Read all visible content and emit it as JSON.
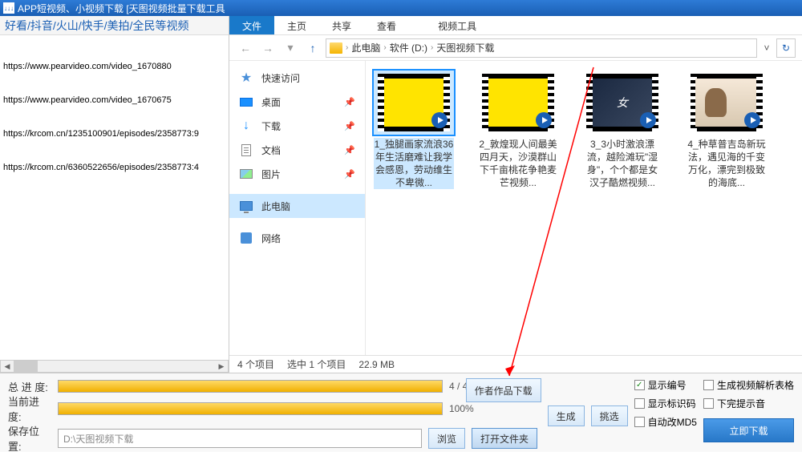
{
  "titlebar": {
    "text": "APP短视频、小视频下载 [天图视频批量下载工具"
  },
  "left_header": "好看/抖音/火山/快手/美拍/全民等视频",
  "urls": [
    "https://www.pearvideo.com/video_1670880",
    "https://www.pearvideo.com/video_1670675",
    "https://krcom.cn/1235100901/episodes/2358773:9",
    "https://krcom.cn/6360522656/episodes/2358773:4"
  ],
  "ribbon": {
    "file": "文件",
    "home": "主页",
    "share": "共享",
    "view": "查看",
    "video_tools": "视频工具"
  },
  "breadcrumb": {
    "pc": "此电脑",
    "drive": "软件 (D:)",
    "folder": "天图视频下载"
  },
  "sidebar": {
    "quick": "快速访问",
    "desktop": "桌面",
    "downloads": "下载",
    "documents": "文档",
    "pictures": "图片",
    "this_pc": "此电脑",
    "network": "网络"
  },
  "files": [
    {
      "name": "1_独腿画家流浪36年生活磨难让我学会感恩，劳动维生不卑微..."
    },
    {
      "name": "2_敦煌现人间最美四月天，沙漠群山下千亩桃花争艳麦芒视频..."
    },
    {
      "name": "3_3小时激浪漂流，越险滩玩\"湿身\"，个个都是女汉子酷燃视频..."
    },
    {
      "name": "4_种草普吉岛新玩法，遇见海的千变万化，漂完到极致的海底..."
    }
  ],
  "status": {
    "count": "4 个项目",
    "selected": "选中 1 个项目",
    "size": "22.9 MB"
  },
  "progress": {
    "total_label": "总 进 度:",
    "total_text": "4 / 4",
    "current_label": "当前进度:",
    "current_text": "100%"
  },
  "save": {
    "label": "保存位置:",
    "path": "D:\\天图视频下载"
  },
  "buttons": {
    "browse": "浏览",
    "open_folder": "打开文件夹",
    "author_works": "作者作品下载",
    "generate": "生成",
    "pick": "挑选",
    "download_now": "立即下载"
  },
  "checkboxes": {
    "show_number": "显示编号",
    "show_id": "显示标识码",
    "auto_md5": "自动改MD5",
    "gen_table": "生成视频解析表格",
    "silent": "下完提示音"
  }
}
